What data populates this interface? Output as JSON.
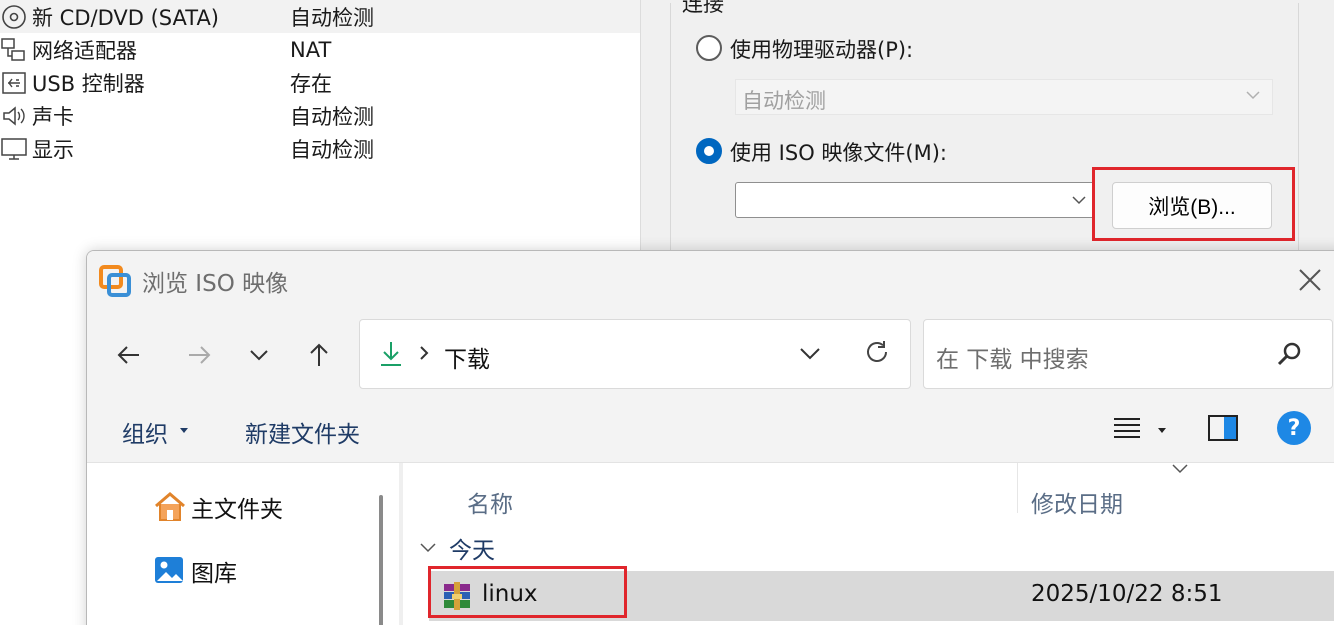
{
  "hardware": [
    {
      "name": "新 CD/DVD (SATA)",
      "value": "自动检测",
      "icon": "cd-dvd-icon"
    },
    {
      "name": "网络适配器",
      "value": "NAT",
      "icon": "network-adapter-icon"
    },
    {
      "name": "USB 控制器",
      "value": "存在",
      "icon": "usb-controller-icon"
    },
    {
      "name": "声卡",
      "value": "自动检测",
      "icon": "speaker-icon"
    },
    {
      "name": "显示",
      "value": "自动检测",
      "icon": "monitor-icon"
    }
  ],
  "connection": {
    "legend": "连接",
    "physical_label": "使用物理驱动器(P):",
    "physical_value": "自动检测",
    "iso_label": "使用 ISO 映像文件(M):",
    "iso_value": "",
    "browse_label": "浏览(B)..."
  },
  "dialog": {
    "title": "浏览 ISO 映像",
    "breadcrumb": "下载",
    "search_placeholder": "在 下载 中搜索",
    "organize_label": "组织",
    "new_folder_label": "新建文件夹",
    "help_label": "?",
    "nav_items": [
      {
        "label": "主文件夹",
        "icon": "home-icon"
      },
      {
        "label": "图库",
        "icon": "gallery-icon"
      }
    ],
    "columns": {
      "name": "名称",
      "modified": "修改日期"
    },
    "group_label": "今天",
    "files": [
      {
        "name": "linux",
        "modified": "2025/10/22 8:51",
        "icon": "winrar-archive-icon"
      }
    ]
  },
  "colors": {
    "accent": "#0067c0",
    "highlight": "#e0262c",
    "selected_row": "#d9d9d9",
    "help": "#1e88e5"
  }
}
